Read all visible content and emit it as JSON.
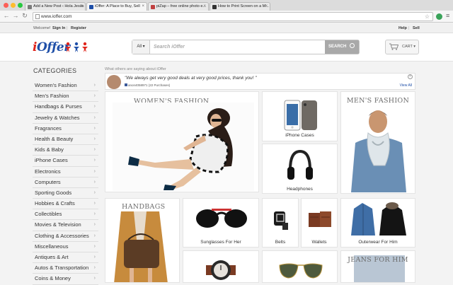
{
  "browser": {
    "tabs": [
      {
        "title": "Add a New Post ‹ Hola Jesús",
        "active": false,
        "favicon_color": "#7a7a7a"
      },
      {
        "title": "iOffer: A Place to Buy, Sell",
        "active": true,
        "favicon_color": "#1f4fa8"
      },
      {
        "title": "piZap – free online photo e...",
        "active": false,
        "favicon_color": "#c04040"
      },
      {
        "title": "How to Print Screen on a M...",
        "active": false,
        "favicon_color": "#333333"
      }
    ],
    "url": "www.ioffer.com",
    "icons": {
      "back": "back-arrow-icon",
      "forward": "forward-arrow-icon",
      "reload": "reload-icon",
      "bookmark": "star-icon",
      "menu": "hamburger-menu-icon"
    }
  },
  "topbar": {
    "welcome": "Welcome!",
    "sign_in": "Sign In",
    "sep": "|",
    "register": "Register",
    "help": "Help",
    "sell": "Sell"
  },
  "header": {
    "logo_a": "i",
    "logo_b": "Offer",
    "search": {
      "category": "All ▾",
      "placeholder": "Search iOffer",
      "button": "SEARCH"
    },
    "cart": "CART ▾"
  },
  "sidebar": {
    "title": "CATEGORIES",
    "items": [
      "Women's Fashion",
      "Men's Fashion",
      "Handbags & Purses",
      "Jewelry & Watches",
      "Fragrances",
      "Health & Beauty",
      "Kids & Baby",
      "iPhone Cases",
      "Electronics",
      "Computers",
      "Sporting Goods",
      "Hobbies & Crafts",
      "Collectibles",
      "Movies & Television",
      "Clothing & Accessories",
      "Miscellaneous",
      "Antiques & Art",
      "Autos & Transportation",
      "Coins & Money"
    ]
  },
  "testimonial": {
    "heading": "What others are saying about iOffer",
    "quote": "\"We always get very good deals at very good prices, thank you! \"",
    "user": "anon4058971 (22 Purchases)",
    "view_all": "View All",
    "close": "×"
  },
  "tiles": {
    "womens": "WOMEN'S FASHION",
    "iphone": "iPhone Cases",
    "mens": "MEN'S FASHION",
    "headphones": "Headphones",
    "handbags": "HANDBAGS",
    "sunglasses": "Sunglasses For Her",
    "belts": "Belts",
    "wallets": "Wallets",
    "outerwear": "Outerwear For Him",
    "jeans": "JEANS FOR HIM"
  },
  "colors": {
    "brand_red": "#e0251b",
    "brand_blue": "#1f4fa8",
    "accent_purple": "#7d6fa8"
  }
}
